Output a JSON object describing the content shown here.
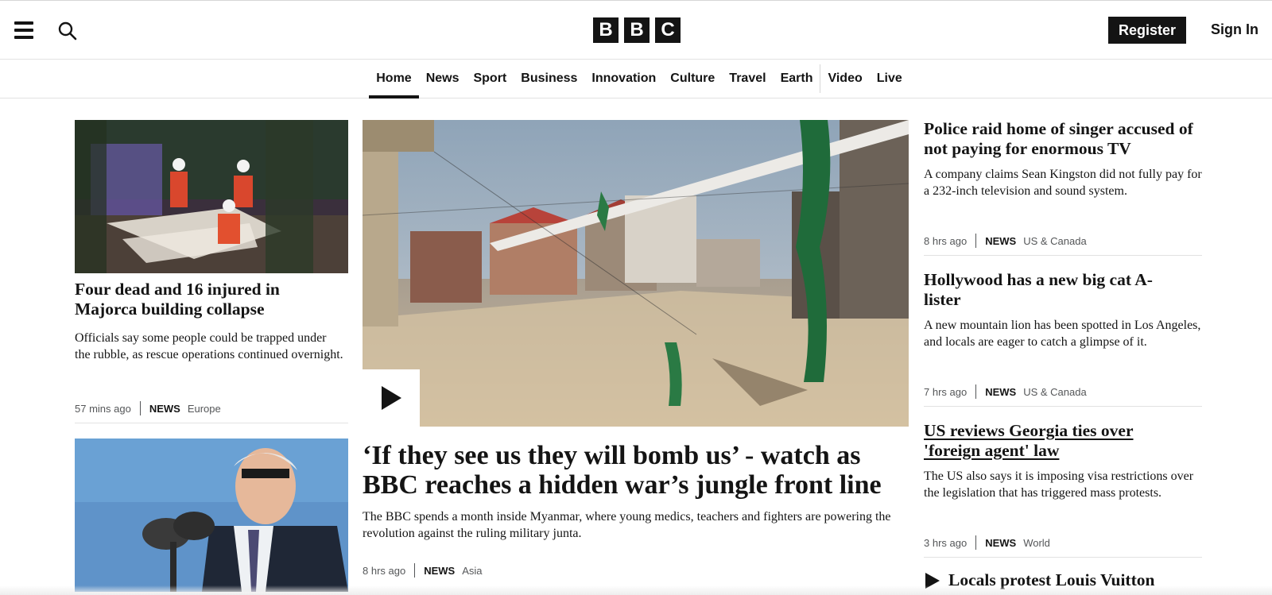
{
  "header": {
    "logo_letters": [
      "B",
      "B",
      "C"
    ],
    "register_label": "Register",
    "signin_label": "Sign In"
  },
  "nav": {
    "items": [
      {
        "label": "Home",
        "active": true
      },
      {
        "label": "News"
      },
      {
        "label": "Sport"
      },
      {
        "label": "Business"
      },
      {
        "label": "Innovation"
      },
      {
        "label": "Culture"
      },
      {
        "label": "Travel"
      },
      {
        "label": "Earth"
      },
      {
        "label": "Video"
      },
      {
        "label": "Live"
      }
    ]
  },
  "left": {
    "story1": {
      "headline": "Four dead and 16 injured in Majorca building collapse",
      "summary": "Officials say some people could be trapped under the rubble, as rescue operations continued overnight.",
      "time": "57 mins ago",
      "category": "NEWS",
      "region": "Europe"
    }
  },
  "center": {
    "headline": "‘If they see us they will bomb us’ - watch as BBC reaches a hidden war’s jungle front line",
    "summary": "The BBC spends a month inside Myanmar, where young medics, teachers and fighters are powering the revolution against the ruling military junta.",
    "time": "8 hrs ago",
    "category": "NEWS",
    "region": "Asia"
  },
  "right": {
    "stories": [
      {
        "headline": "Police raid home of singer accused of not paying for enormous TV",
        "summary": "A company claims Sean Kingston did not fully pay for a 232-inch television and sound system.",
        "time": "8 hrs ago",
        "category": "NEWS",
        "region": "US & Canada"
      },
      {
        "headline": "Hollywood has a new big cat A-lister",
        "summary": "A new mountain lion has been spotted in Los Angeles, and locals are eager to catch a glimpse of it.",
        "time": "7 hrs ago",
        "category": "NEWS",
        "region": "US & Canada"
      },
      {
        "headline": "US reviews Georgia ties over 'foreign agent' law",
        "summary": "The US also says it is imposing visa restrictions over the legislation that has triggered mass protests.",
        "time": "3 hrs ago",
        "category": "NEWS",
        "region": "World"
      },
      {
        "headline": "Locals protest Louis Vuitton"
      }
    ]
  }
}
